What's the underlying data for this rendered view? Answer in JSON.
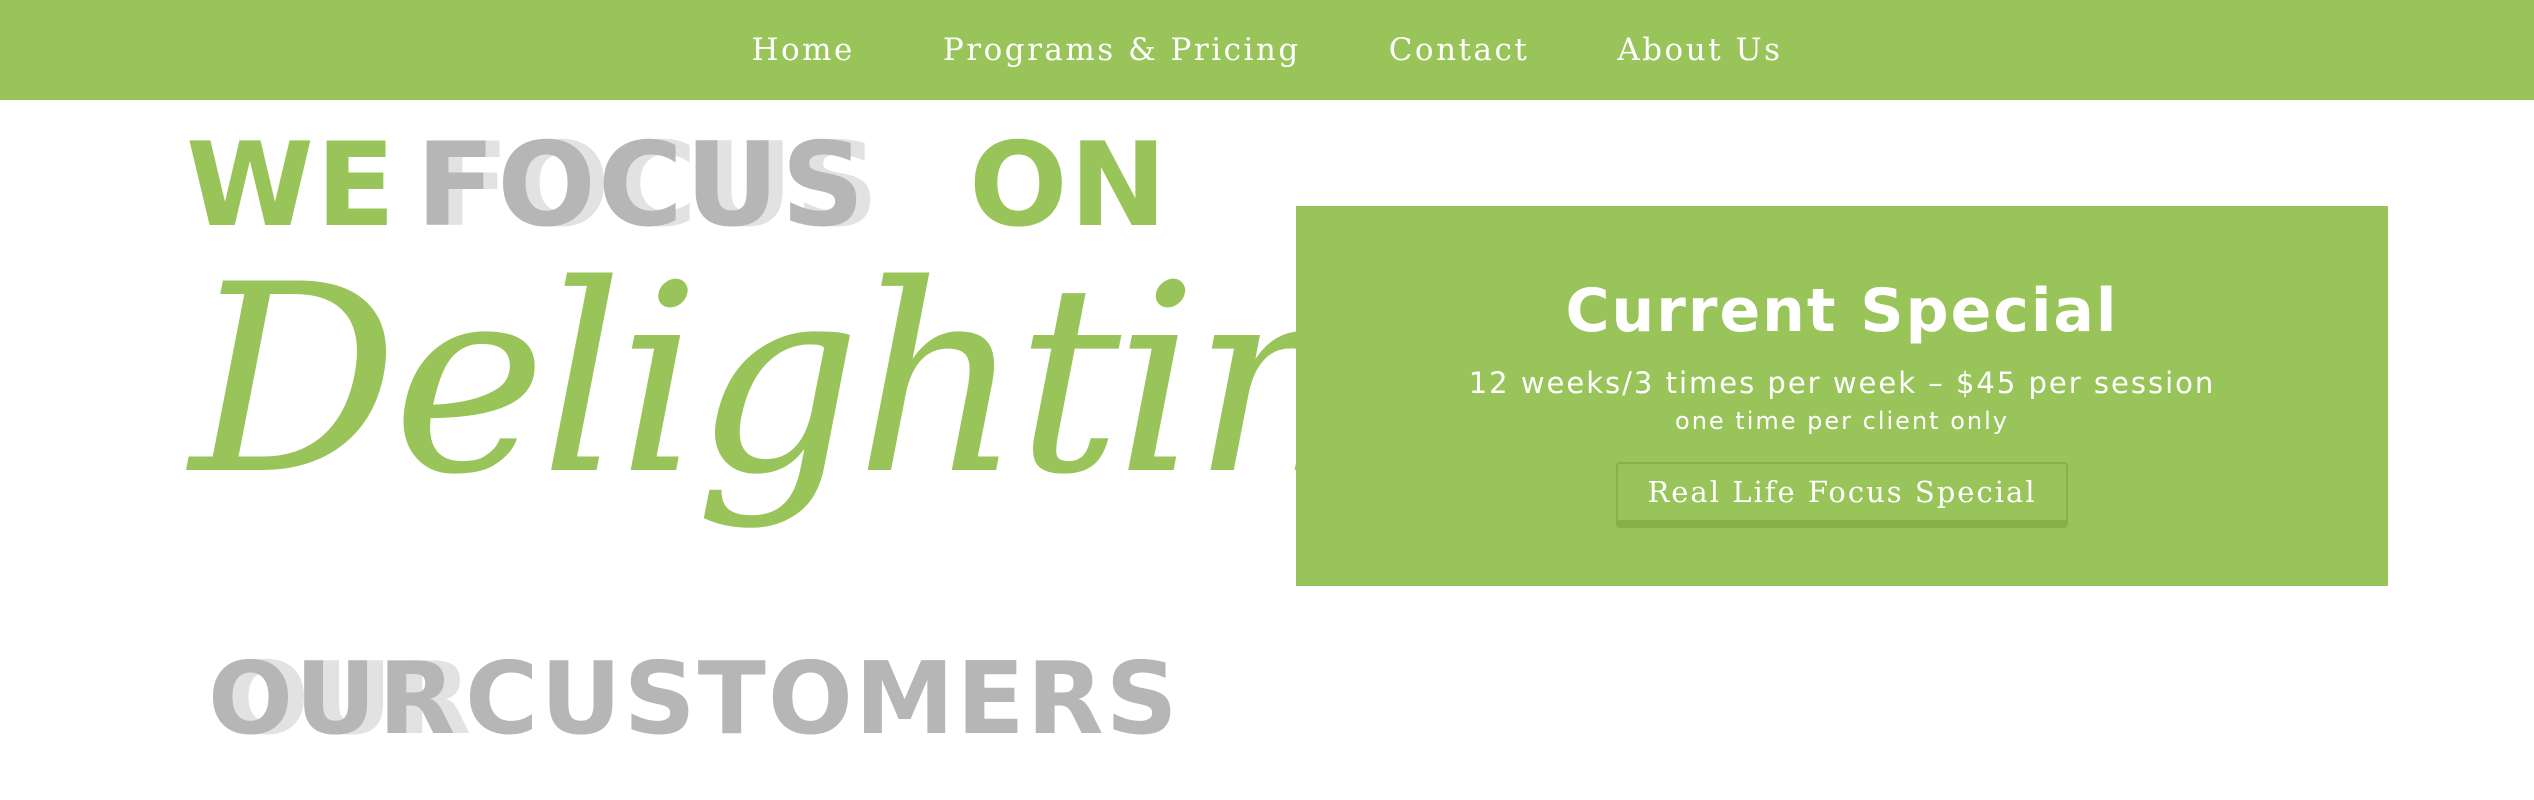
{
  "nav": {
    "items": [
      {
        "label": "Home"
      },
      {
        "label": "Programs & Pricing"
      },
      {
        "label": "Contact"
      },
      {
        "label": "About Us"
      }
    ]
  },
  "hero": {
    "line1_we": "WE",
    "line1_focus": "FOCUS",
    "line1_on": "ON",
    "script_word": "Delighting",
    "line3_our": "OUR",
    "line3_customers": "CUSTOMERS",
    "colors": {
      "green": "#98c45a",
      "gray": "#b6b6b6",
      "gray_shadow": "#e2e2e2"
    }
  },
  "special": {
    "title": "Current Special",
    "detail": "12 weeks/3 times per week – $45 per session",
    "note": "one time per client only",
    "button_label": "Real Life Focus Special",
    "background_color": "#98c45a"
  },
  "colors": {
    "brand_green": "#98c45a",
    "button_border": "#86b049",
    "text_on_green": "#ffffff"
  }
}
